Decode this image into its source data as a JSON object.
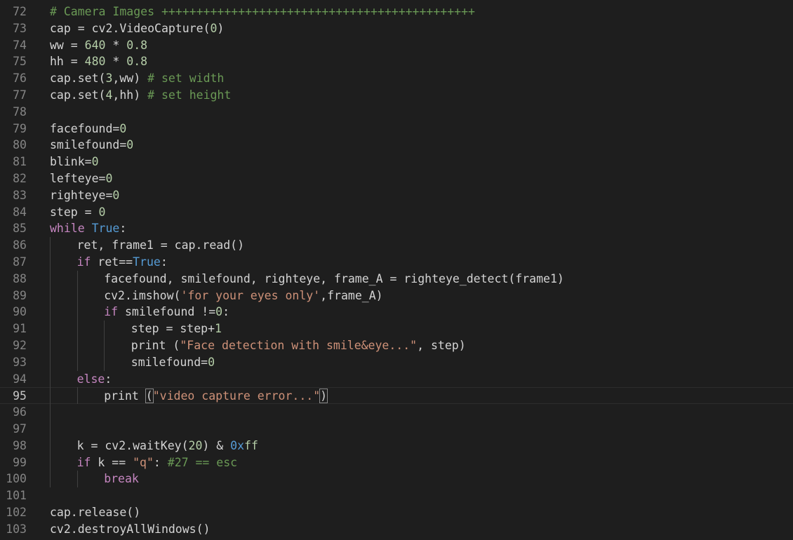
{
  "editor": {
    "language": "python",
    "current_line": 95,
    "colors": {
      "background": "#1e1e1e",
      "line_number": "#858585",
      "keyword": "#c586c0",
      "constant": "#569cd6",
      "number": "#b5cea8",
      "string": "#ce9178",
      "comment": "#6a9955",
      "text": "#d4d4d4"
    },
    "lines": [
      {
        "n": "72",
        "indent": 0,
        "tokens": [
          {
            "t": "com",
            "v": "# Camera Images +++++++++++++++++++++++++++++++++++++++++++++"
          }
        ]
      },
      {
        "n": "73",
        "indent": 0,
        "tokens": [
          {
            "t": "plain",
            "v": "cap = cv2.VideoCapture("
          },
          {
            "t": "num",
            "v": "0"
          },
          {
            "t": "plain",
            "v": ")"
          }
        ]
      },
      {
        "n": "74",
        "indent": 0,
        "tokens": [
          {
            "t": "plain",
            "v": "ww = "
          },
          {
            "t": "num",
            "v": "640"
          },
          {
            "t": "plain",
            "v": " * "
          },
          {
            "t": "num",
            "v": "0.8"
          }
        ]
      },
      {
        "n": "75",
        "indent": 0,
        "tokens": [
          {
            "t": "plain",
            "v": "hh = "
          },
          {
            "t": "num",
            "v": "480"
          },
          {
            "t": "plain",
            "v": " * "
          },
          {
            "t": "num",
            "v": "0.8"
          }
        ]
      },
      {
        "n": "76",
        "indent": 0,
        "tokens": [
          {
            "t": "plain",
            "v": "cap.set("
          },
          {
            "t": "num",
            "v": "3"
          },
          {
            "t": "plain",
            "v": ",ww) "
          },
          {
            "t": "com",
            "v": "# set width"
          }
        ]
      },
      {
        "n": "77",
        "indent": 0,
        "tokens": [
          {
            "t": "plain",
            "v": "cap.set("
          },
          {
            "t": "num",
            "v": "4"
          },
          {
            "t": "plain",
            "v": ",hh) "
          },
          {
            "t": "com",
            "v": "# set height"
          }
        ]
      },
      {
        "n": "78",
        "indent": 0,
        "tokens": []
      },
      {
        "n": "79",
        "indent": 0,
        "tokens": [
          {
            "t": "plain",
            "v": "facefound="
          },
          {
            "t": "num",
            "v": "0"
          }
        ]
      },
      {
        "n": "80",
        "indent": 0,
        "tokens": [
          {
            "t": "plain",
            "v": "smilefound="
          },
          {
            "t": "num",
            "v": "0"
          }
        ]
      },
      {
        "n": "81",
        "indent": 0,
        "tokens": [
          {
            "t": "plain",
            "v": "blink="
          },
          {
            "t": "num",
            "v": "0"
          }
        ]
      },
      {
        "n": "82",
        "indent": 0,
        "tokens": [
          {
            "t": "plain",
            "v": "lefteye="
          },
          {
            "t": "num",
            "v": "0"
          }
        ]
      },
      {
        "n": "83",
        "indent": 0,
        "tokens": [
          {
            "t": "plain",
            "v": "righteye="
          },
          {
            "t": "num",
            "v": "0"
          }
        ]
      },
      {
        "n": "84",
        "indent": 0,
        "tokens": [
          {
            "t": "plain",
            "v": "step = "
          },
          {
            "t": "num",
            "v": "0"
          }
        ]
      },
      {
        "n": "85",
        "indent": 0,
        "tokens": [
          {
            "t": "kw",
            "v": "while"
          },
          {
            "t": "plain",
            "v": " "
          },
          {
            "t": "const",
            "v": "True"
          },
          {
            "t": "plain",
            "v": ":"
          }
        ]
      },
      {
        "n": "86",
        "indent": 1,
        "tokens": [
          {
            "t": "plain",
            "v": "ret, frame1 = cap.read()"
          }
        ]
      },
      {
        "n": "87",
        "indent": 1,
        "tokens": [
          {
            "t": "kw",
            "v": "if"
          },
          {
            "t": "plain",
            "v": " ret=="
          },
          {
            "t": "const",
            "v": "True"
          },
          {
            "t": "plain",
            "v": ":"
          }
        ]
      },
      {
        "n": "88",
        "indent": 2,
        "tokens": [
          {
            "t": "plain",
            "v": "facefound, smilefound, righteye, frame_A = righteye_detect(frame1)"
          }
        ]
      },
      {
        "n": "89",
        "indent": 2,
        "tokens": [
          {
            "t": "plain",
            "v": "cv2.imshow("
          },
          {
            "t": "str",
            "v": "'for your eyes only'"
          },
          {
            "t": "plain",
            "v": ",frame_A)"
          }
        ]
      },
      {
        "n": "90",
        "indent": 2,
        "tokens": [
          {
            "t": "kw",
            "v": "if"
          },
          {
            "t": "plain",
            "v": " smilefound !="
          },
          {
            "t": "num",
            "v": "0"
          },
          {
            "t": "plain",
            "v": ":"
          }
        ]
      },
      {
        "n": "91",
        "indent": 3,
        "tokens": [
          {
            "t": "plain",
            "v": "step = step+"
          },
          {
            "t": "num",
            "v": "1"
          }
        ]
      },
      {
        "n": "92",
        "indent": 3,
        "tokens": [
          {
            "t": "plain",
            "v": "print ("
          },
          {
            "t": "str",
            "v": "\"Face detection with smile&eye...\""
          },
          {
            "t": "plain",
            "v": ", step)"
          }
        ]
      },
      {
        "n": "93",
        "indent": 3,
        "tokens": [
          {
            "t": "plain",
            "v": "smilefound="
          },
          {
            "t": "num",
            "v": "0"
          }
        ]
      },
      {
        "n": "94",
        "indent": 1,
        "tokens": [
          {
            "t": "kw",
            "v": "else"
          },
          {
            "t": "plain",
            "v": ":"
          }
        ]
      },
      {
        "n": "95",
        "indent": 2,
        "tokens": [
          {
            "t": "plain",
            "v": "print "
          },
          {
            "t": "plain",
            "v": "(",
            "match": true
          },
          {
            "t": "str",
            "v": "\"video capture error...\""
          },
          {
            "t": "plain",
            "v": ")",
            "match": true
          }
        ]
      },
      {
        "n": "96",
        "indent": 0,
        "tokens": []
      },
      {
        "n": "97",
        "indent": 0,
        "tokens": []
      },
      {
        "n": "98",
        "indent": 1,
        "tokens": [
          {
            "t": "plain",
            "v": "k = cv2.waitKey("
          },
          {
            "t": "num",
            "v": "20"
          },
          {
            "t": "plain",
            "v": ") & "
          },
          {
            "t": "const",
            "v": "0x"
          },
          {
            "t": "num",
            "v": "ff"
          }
        ]
      },
      {
        "n": "99",
        "indent": 1,
        "tokens": [
          {
            "t": "kw",
            "v": "if"
          },
          {
            "t": "plain",
            "v": " k == "
          },
          {
            "t": "str",
            "v": "\"q\""
          },
          {
            "t": "plain",
            "v": ": "
          },
          {
            "t": "com",
            "v": "#27 == esc"
          }
        ]
      },
      {
        "n": "100",
        "indent": 2,
        "tokens": [
          {
            "t": "kw",
            "v": "break"
          }
        ]
      },
      {
        "n": "101",
        "indent": 0,
        "tokens": []
      },
      {
        "n": "102",
        "indent": 0,
        "tokens": [
          {
            "t": "plain",
            "v": "cap.release()"
          }
        ]
      },
      {
        "n": "103",
        "indent": 0,
        "tokens": [
          {
            "t": "plain",
            "v": "cv2.destroyAllWindows()"
          }
        ]
      }
    ]
  }
}
